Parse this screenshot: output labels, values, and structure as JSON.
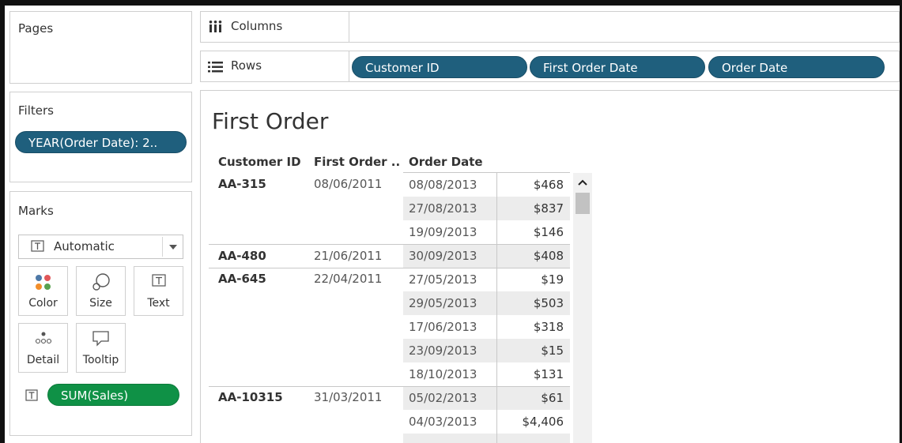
{
  "sidebar": {
    "pages_title": "Pages",
    "filters_title": "Filters",
    "filter_pill": "YEAR(Order Date): 2..",
    "marks_title": "Marks",
    "mark_type": "Automatic",
    "buttons": {
      "color": "Color",
      "size": "Size",
      "text": "Text",
      "detail": "Detail",
      "tooltip": "Tooltip"
    },
    "measure_pill": "SUM(Sales)"
  },
  "shelves": {
    "columns_label": "Columns",
    "rows_label": "Rows",
    "row_pills": [
      "Customer ID",
      "First Order Date",
      "Order Date"
    ]
  },
  "view": {
    "title": "First Order",
    "headers": {
      "customer_id": "Customer ID",
      "first_order": "First Order ..",
      "order_date": "Order Date"
    },
    "groups": [
      {
        "customer_id": "AA-315",
        "first_order": "08/06/2011",
        "rows": [
          {
            "order_date": "08/08/2013",
            "sales": "$468"
          },
          {
            "order_date": "27/08/2013",
            "sales": "$837"
          },
          {
            "order_date": "19/09/2013",
            "sales": "$146"
          }
        ]
      },
      {
        "customer_id": "AA-480",
        "first_order": "21/06/2011",
        "rows": [
          {
            "order_date": "30/09/2013",
            "sales": "$408"
          }
        ]
      },
      {
        "customer_id": "AA-645",
        "first_order": "22/04/2011",
        "rows": [
          {
            "order_date": "27/05/2013",
            "sales": "$19"
          },
          {
            "order_date": "29/05/2013",
            "sales": "$503"
          },
          {
            "order_date": "17/06/2013",
            "sales": "$318"
          },
          {
            "order_date": "23/09/2013",
            "sales": "$15"
          },
          {
            "order_date": "18/10/2013",
            "sales": "$131"
          }
        ]
      },
      {
        "customer_id": "AA-10315",
        "first_order": "31/03/2011",
        "rows": [
          {
            "order_date": "05/02/2013",
            "sales": "$61"
          },
          {
            "order_date": "04/03/2013",
            "sales": "$4,406"
          }
        ]
      }
    ]
  },
  "colors": {
    "pill_blue": "#1f5f7d",
    "pill_green": "#0f9146",
    "band_gray": "#ececec"
  }
}
